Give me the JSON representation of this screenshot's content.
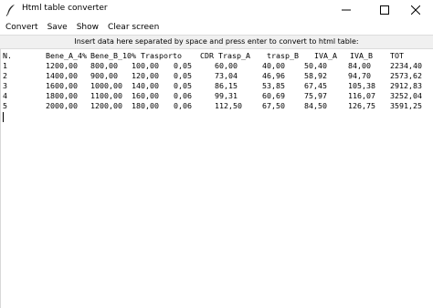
{
  "window": {
    "title": "Html table converter",
    "icon": "feather-icon"
  },
  "menu": {
    "items": [
      "Convert",
      "Save",
      "Show",
      "Clear screen"
    ]
  },
  "instruction": "Insert data here separated by space and press enter to convert to html table:",
  "table": {
    "headers": [
      "N.",
      "Bene_A_4%",
      "Bene_B_10%",
      "Trasporto",
      "CDR",
      "Trasp_A",
      "trasp_B",
      "IVA_A",
      "IVA_B",
      "TOT"
    ],
    "rows": [
      [
        "1",
        "1200,00",
        "800,00",
        "100,00",
        "0,05",
        "60,00",
        "40,00",
        "50,40",
        "84,00",
        "2234,40"
      ],
      [
        "2",
        "1400,00",
        "900,00",
        "120,00",
        "0,05",
        "73,04",
        "46,96",
        "58,92",
        "94,70",
        "2573,62"
      ],
      [
        "3",
        "1600,00",
        "1000,00",
        "140,00",
        "0,05",
        "86,15",
        "53,85",
        "67,45",
        "105,38",
        "2912,83"
      ],
      [
        "4",
        "1800,00",
        "1100,00",
        "160,00",
        "0,06",
        "99,31",
        "60,69",
        "75,97",
        "116,07",
        "3252,04"
      ],
      [
        "5",
        "2000,00",
        "1200,00",
        "180,00",
        "0,06",
        "112,50",
        "67,50",
        "84,50",
        "126,75",
        "3591,25"
      ]
    ]
  }
}
